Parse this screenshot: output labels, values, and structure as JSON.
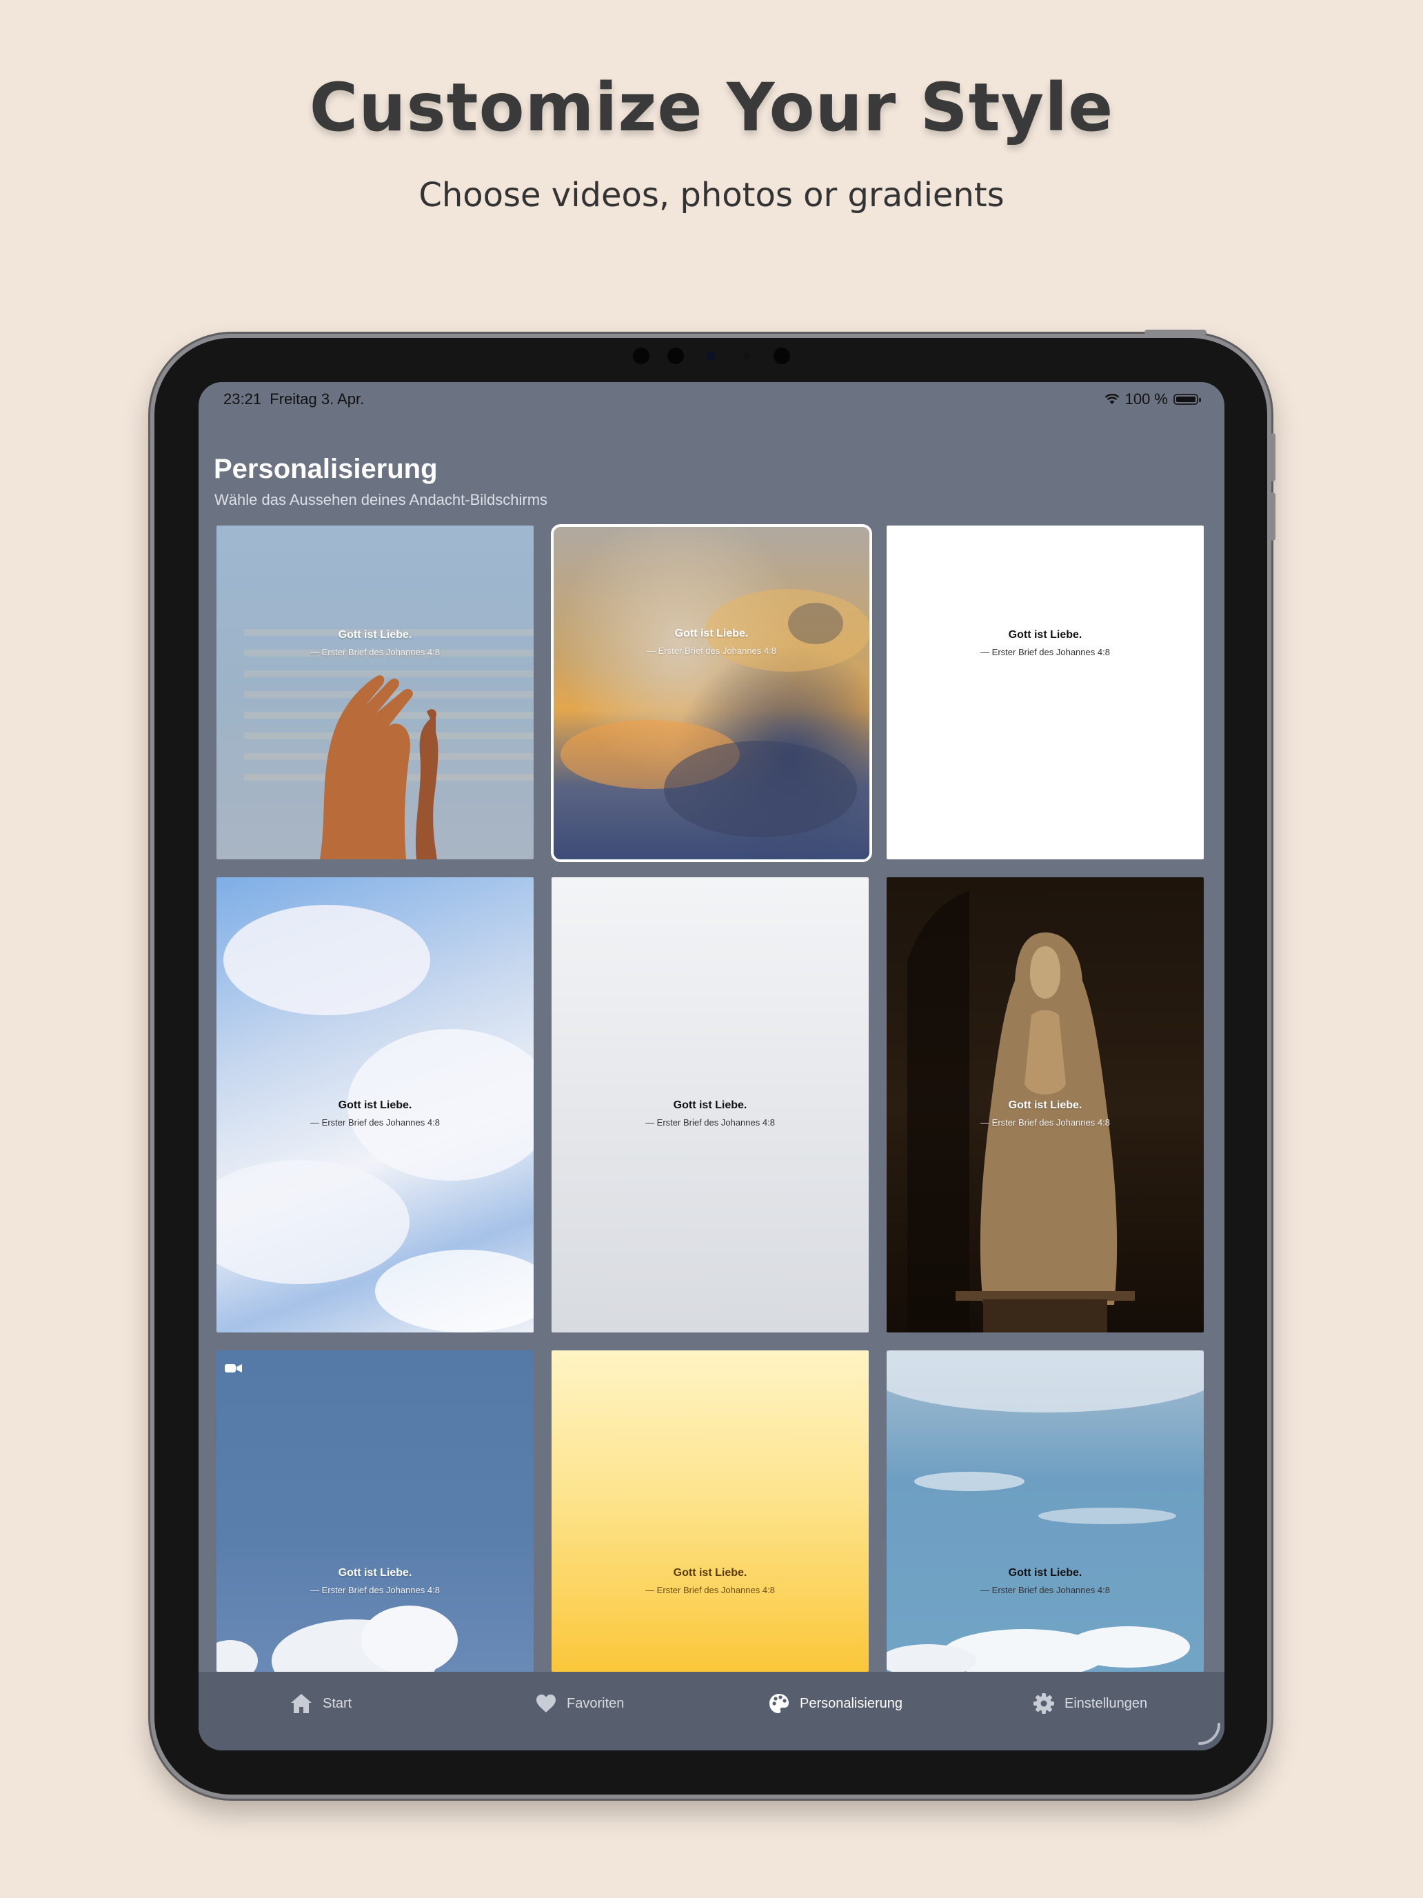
{
  "promo": {
    "headline": "Customize Your Style",
    "subheadline": "Choose videos, photos or gradients"
  },
  "status_bar": {
    "time": "23:21",
    "date": "Freitag 3. Apr.",
    "battery": "100 %"
  },
  "header": {
    "title": "Personalisierung",
    "subtitle": "Wähle das Aussehen deines Andacht-Bildschirms"
  },
  "backgrounds": [
    {
      "kind": "photo",
      "subject": "hands against blue sky",
      "quote": "Gott ist Liebe.",
      "reference": "— Erster Brief des Johannes 4:8",
      "selected": false
    },
    {
      "kind": "photo",
      "subject": "golden clouds",
      "quote": "Gott ist Liebe.",
      "reference": "— Erster Brief des Johannes 4:8",
      "selected": true
    },
    {
      "kind": "gradient",
      "subject": "white",
      "quote": "Gott ist Liebe.",
      "reference": "— Erster Brief des Johannes 4:8",
      "selected": false
    },
    {
      "kind": "photo",
      "subject": "white clouds in blue sky",
      "quote": "Gott ist Liebe.",
      "reference": "— Erster Brief des Johannes 4:8",
      "selected": false
    },
    {
      "kind": "gradient",
      "subject": "light grey",
      "quote": "Gott ist Liebe.",
      "reference": "— Erster Brief des Johannes 4:8",
      "selected": false
    },
    {
      "kind": "photo",
      "subject": "statue in church",
      "quote": "Gott ist Liebe.",
      "reference": "— Erster Brief des Johannes 4:8",
      "selected": false
    },
    {
      "kind": "video",
      "subject": "blue sky with cloud",
      "quote": "Gott ist Liebe.",
      "reference": "— Erster Brief des Johannes 4:8",
      "selected": false,
      "icon": "video-camera-icon"
    },
    {
      "kind": "gradient",
      "subject": "yellow",
      "quote": "Gott ist Liebe.",
      "reference": "— Erster Brief des Johannes 4:8",
      "selected": false
    },
    {
      "kind": "photo",
      "subject": "sky with clouds",
      "quote": "Gott ist Liebe.",
      "reference": "— Erster Brief des Johannes 4:8",
      "selected": false
    }
  ],
  "tabs": [
    {
      "label": "Start",
      "icon": "house-icon",
      "active": false
    },
    {
      "label": "Favoriten",
      "icon": "heart-icon",
      "active": false
    },
    {
      "label": "Personalisierung",
      "icon": "palette-icon",
      "active": true
    },
    {
      "label": "Einstellungen",
      "icon": "gear-icon",
      "active": false
    }
  ],
  "colors": {
    "page_background": "#f2e6da",
    "screen_background": "#6b7282",
    "tab_bar": "#575f6f",
    "headline": "#3a3a3a"
  }
}
